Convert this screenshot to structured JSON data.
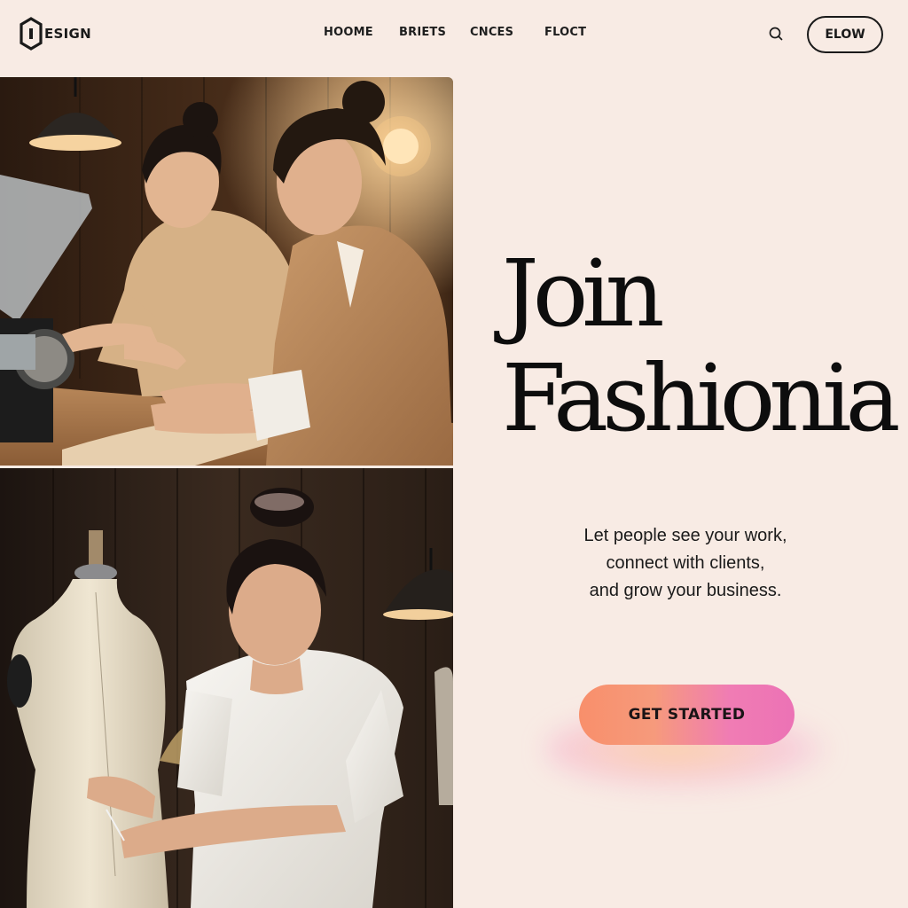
{
  "header": {
    "logo_text": "ESIGN",
    "nav": [
      {
        "label": "HOOME"
      },
      {
        "label": "BRIETS"
      },
      {
        "label": "CNCES"
      },
      {
        "label": "FLOCT"
      }
    ],
    "action_label": "ELOW",
    "search_icon": "search-icon"
  },
  "hero": {
    "title_line1": "Join",
    "title_line2": "Fashionia",
    "subtitle_lines": [
      "Let people see your work,",
      "connect with clients,",
      "and grow your business."
    ],
    "cta_label": "GET STARTED"
  },
  "images": {
    "top_photo": "two-women-sewing-in-atelier",
    "bottom_photo": "woman-measuring-dress-form"
  },
  "colors": {
    "background": "#f8ebe4",
    "cta_gradient_start": "#f88f6b",
    "cta_gradient_end": "#ec72b5",
    "text": "#111111"
  }
}
